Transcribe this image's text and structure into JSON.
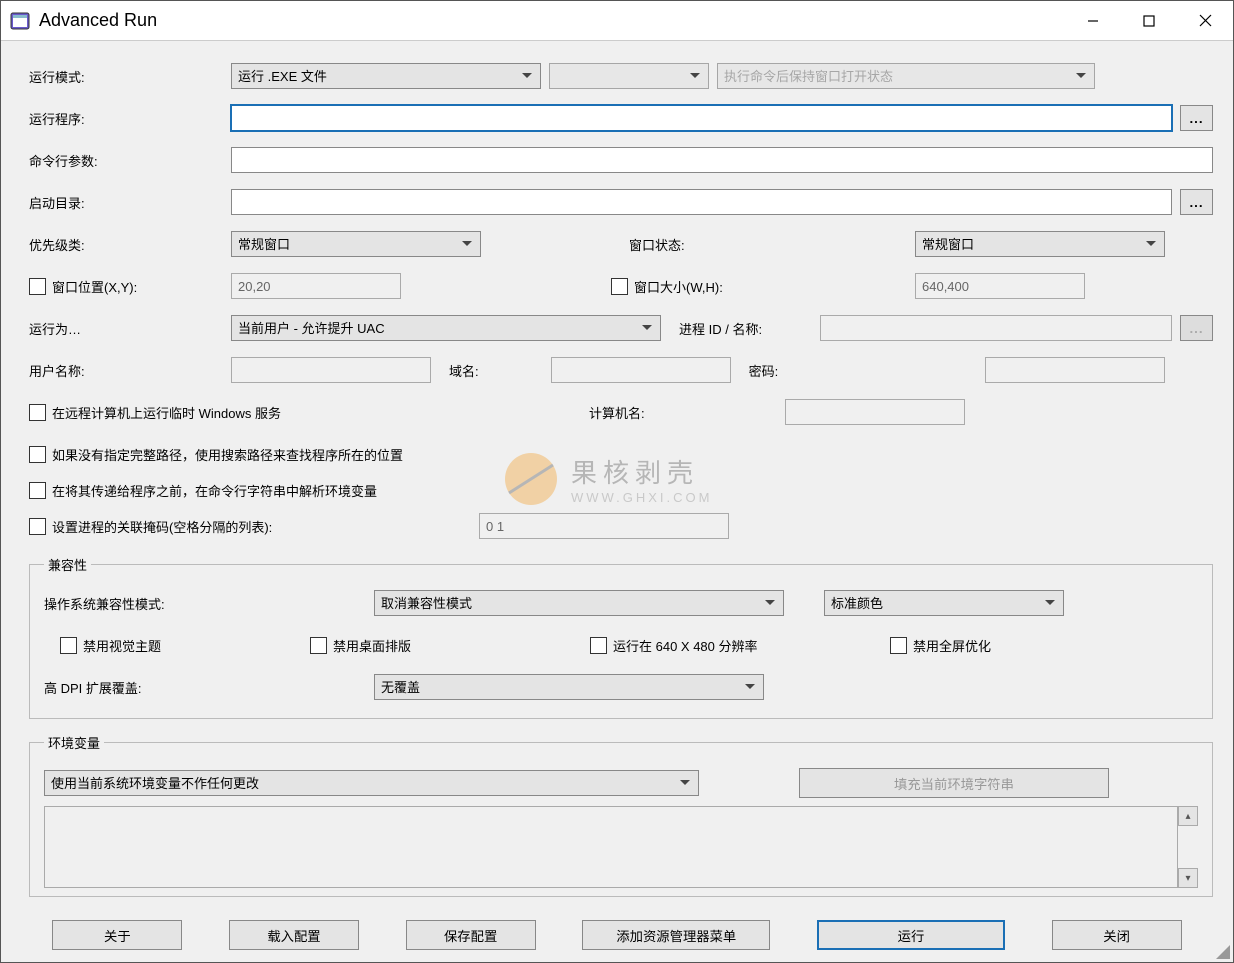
{
  "window": {
    "title": "Advanced Run"
  },
  "labels": {
    "runMode": "运行模式:",
    "runProgram": "运行程序:",
    "cmdParams": "命令行参数:",
    "startDir": "启动目录:",
    "priority": "优先级类:",
    "winState": "窗口状态:",
    "winPos": "窗口位置(X,Y):",
    "winSize": "窗口大小(W,H):",
    "runAs": "运行为…",
    "procId": "进程 ID / 名称:",
    "userName": "用户名称:",
    "domain": "域名:",
    "password": "密码:",
    "remoteService": "在远程计算机上运行临时 Windows 服务",
    "computerName": "计算机名:",
    "searchPath": "如果没有指定完整路径，使用搜索路径来查找程序所在的位置",
    "parseEnv": "在将其传递给程序之前，在命令行字符串中解析环境变量",
    "affinity": "设置进程的关联掩码(空格分隔的列表):",
    "compat": "兼容性",
    "osCompat": "操作系统兼容性模式:",
    "disableVisualTheme": "禁用视觉主题",
    "disableDesktopComp": "禁用桌面排版",
    "run640": "运行在 640 X 480 分辨率",
    "disableFullscreen": "禁用全屏优化",
    "highDpi": "高 DPI 扩展覆盖:",
    "envVars": "环境变量",
    "btnAbout": "关于",
    "btnLoad": "载入配置",
    "btnSave": "保存配置",
    "btnExplorer": "添加资源管理器菜单",
    "btnRun": "运行",
    "btnClose": "关闭",
    "fillEnv": "填充当前环境字符串"
  },
  "values": {
    "runMode": "运行 .EXE 文件",
    "keepOpen": "执行命令后保持窗口打开状态",
    "priority": "常规窗口",
    "winState": "常规窗口",
    "winPos": "20,20",
    "winSize": "640,400",
    "runAs": "当前用户 - 允许提升 UAC",
    "affinity": "0 1",
    "osCompat": "取消兼容性模式",
    "stdColor": "标准颜色",
    "highDpi": "无覆盖",
    "envMode": "使用当前系统环境变量不作任何更改",
    "browse": "..."
  },
  "watermark": {
    "text1": "果核剥壳",
    "text2": "WWW.GHXI.COM"
  }
}
